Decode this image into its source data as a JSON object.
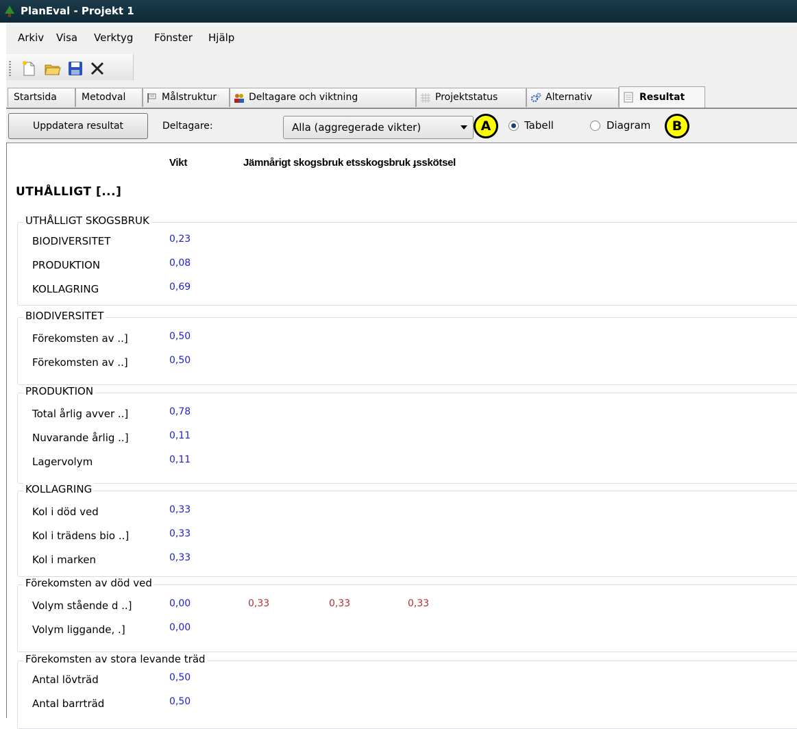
{
  "window": {
    "title": "PlanEval - Projekt 1"
  },
  "menu": [
    "Arkiv",
    "Visa",
    "Verktyg",
    "Fönster",
    "Hjälp"
  ],
  "tabs": [
    {
      "label": "Startsida",
      "icon": "none"
    },
    {
      "label": "Metodval",
      "icon": "none"
    },
    {
      "label": "Målstruktur",
      "icon": "flag-icon"
    },
    {
      "label": "Deltagare och viktning",
      "icon": "people-icon"
    },
    {
      "label": "Projektstatus",
      "icon": "grid-icon"
    },
    {
      "label": "Alternativ",
      "icon": "gears-icon"
    },
    {
      "label": "Resultat",
      "icon": "document-icon",
      "active": true
    }
  ],
  "options": {
    "update_button": "Uppdatera resultat",
    "participants_label": "Deltagare:",
    "participants_value": "Alla (aggregerade vikter)",
    "radio_table": "Tabell",
    "radio_chart": "Diagram",
    "selected_view": "Tabell",
    "callout_a": "A",
    "callout_b": "B"
  },
  "table": {
    "weight_header": "Vikt",
    "alternatives_header": "Jämnårigt skogsbruk etsskogsbruk ɟsskötsel",
    "top_title": "UTHÅLLIGT  [...]",
    "groups": [
      {
        "title": "UTHÅLLIGT SKOGSBRUK",
        "rows": [
          {
            "name": "BIODIVERSITET",
            "weight": "0,23"
          },
          {
            "name": "PRODUKTION",
            "weight": "0,08"
          },
          {
            "name": "KOLLAGRING",
            "weight": "0,69"
          }
        ]
      },
      {
        "title": "BIODIVERSITET",
        "rows": [
          {
            "name": "Förekomsten av  ..]",
            "weight": "0,50"
          },
          {
            "name": "Förekomsten av  ..]",
            "weight": "0,50"
          }
        ]
      },
      {
        "title": "PRODUKTION",
        "rows": [
          {
            "name": "Total årlig avver ..]",
            "weight": "0,78"
          },
          {
            "name": "Nuvarande årlig  ..]",
            "weight": "0,11"
          },
          {
            "name": "Lagervolym",
            "weight": "0,11"
          }
        ]
      },
      {
        "title": "KOLLAGRING",
        "rows": [
          {
            "name": "Kol i död ved",
            "weight": "0,33"
          },
          {
            "name": "Kol i trädens bio ..]",
            "weight": "0,33"
          },
          {
            "name": "Kol i marken",
            "weight": "0,33"
          }
        ]
      },
      {
        "title": "Förekomsten av död ved",
        "rows": [
          {
            "name": "Volym stående d ..]",
            "weight": "0,00",
            "alt": [
              "0,33",
              "0,33",
              "0,33"
            ]
          },
          {
            "name": "Volym liggande,  .]",
            "weight": "0,00"
          }
        ]
      },
      {
        "title": "Förekomsten av stora levande träd",
        "rows": [
          {
            "name": "Antal lövträd",
            "weight": "0,50"
          },
          {
            "name": "Antal barrträd",
            "weight": "0,50"
          }
        ]
      }
    ]
  }
}
